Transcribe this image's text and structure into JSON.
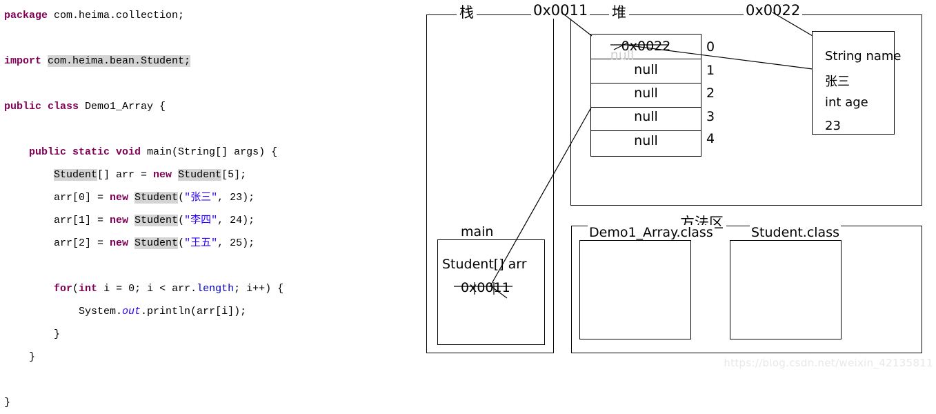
{
  "code": {
    "language": "java",
    "lines": [
      [
        {
          "t": "package ",
          "c": "kw"
        },
        {
          "t": "com.heima.collection;",
          "c": "pln"
        }
      ],
      [],
      [
        {
          "t": "import ",
          "c": "kw"
        },
        {
          "t": "com.heima.bean.Student;",
          "c": "pln hl"
        }
      ],
      [],
      [
        {
          "t": "public class ",
          "c": "kw"
        },
        {
          "t": "Demo1_Array {",
          "c": "pln"
        }
      ],
      [],
      [
        {
          "t": "    public static void ",
          "c": "kw"
        },
        {
          "t": "main(String[] args) {",
          "c": "pln"
        }
      ],
      [
        {
          "t": "        ",
          "c": "pln"
        },
        {
          "t": "Student",
          "c": "pln hl"
        },
        {
          "t": "[] arr = ",
          "c": "pln"
        },
        {
          "t": "new ",
          "c": "kw"
        },
        {
          "t": "Student",
          "c": "pln hl"
        },
        {
          "t": "[5];",
          "c": "pln"
        }
      ],
      [
        {
          "t": "        arr[0] = ",
          "c": "pln"
        },
        {
          "t": "new ",
          "c": "kw"
        },
        {
          "t": "Student",
          "c": "pln hl"
        },
        {
          "t": "(",
          "c": "pln"
        },
        {
          "t": "\"张三\"",
          "c": "str"
        },
        {
          "t": ", 23);",
          "c": "pln"
        }
      ],
      [
        {
          "t": "        arr[1] = ",
          "c": "pln"
        },
        {
          "t": "new ",
          "c": "kw"
        },
        {
          "t": "Student",
          "c": "pln hl"
        },
        {
          "t": "(",
          "c": "pln"
        },
        {
          "t": "\"李四\"",
          "c": "str"
        },
        {
          "t": ", 24);",
          "c": "pln"
        }
      ],
      [
        {
          "t": "        arr[2] = ",
          "c": "pln"
        },
        {
          "t": "new ",
          "c": "kw"
        },
        {
          "t": "Student",
          "c": "pln hl"
        },
        {
          "t": "(",
          "c": "pln"
        },
        {
          "t": "\"王五\"",
          "c": "str"
        },
        {
          "t": ", 25);",
          "c": "pln"
        }
      ],
      [],
      [
        {
          "t": "        ",
          "c": "pln"
        },
        {
          "t": "for",
          "c": "kw"
        },
        {
          "t": "(",
          "c": "pln"
        },
        {
          "t": "int ",
          "c": "kw"
        },
        {
          "t": "i = 0; i < arr.",
          "c": "pln"
        },
        {
          "t": "length",
          "c": "fld"
        },
        {
          "t": "; i++) {",
          "c": "pln"
        }
      ],
      [
        {
          "t": "            System.",
          "c": "pln"
        },
        {
          "t": "out",
          "c": "itl"
        },
        {
          "t": ".println(arr[i]);",
          "c": "pln"
        }
      ],
      [
        {
          "t": "        }",
          "c": "pln"
        }
      ],
      [
        {
          "t": "    }",
          "c": "pln"
        }
      ],
      [],
      [
        {
          "t": "}",
          "c": "pln"
        }
      ]
    ]
  },
  "diagram": {
    "stack": {
      "title": "栈",
      "frame_label": "main",
      "variable_name": "Student[] arr",
      "variable_value": "0x0011"
    },
    "heap": {
      "title": "堆",
      "array_address_label": "0x0011",
      "object_address_label": "0x0022",
      "array_cells": [
        {
          "index": "0",
          "value": "0x0022"
        },
        {
          "index": "1",
          "value": "null"
        },
        {
          "index": "2",
          "value": "null"
        },
        {
          "index": "3",
          "value": "null"
        },
        {
          "index": "4",
          "value": "null"
        }
      ],
      "student_object": {
        "field1_type": "String name",
        "field1_value": "张三",
        "field2_type": "int age",
        "field2_value": "23"
      }
    },
    "method_area": {
      "title": "方法区",
      "classes": [
        "Demo1_Array.class",
        "Student.class"
      ]
    }
  },
  "watermark": "https://blog.csdn.net/weixin_42135811"
}
